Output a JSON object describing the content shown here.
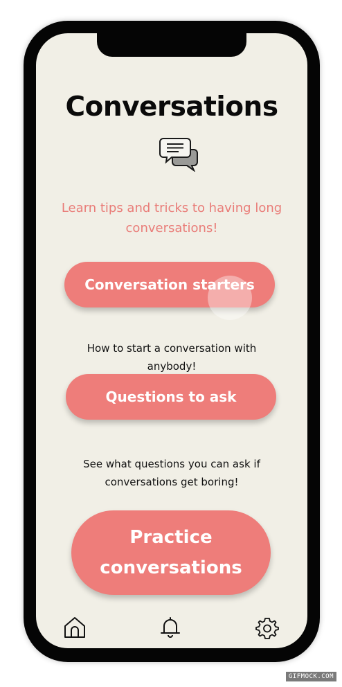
{
  "header": {
    "title": "Conversations",
    "subtitle": "Learn tips and tricks to having long conversations!",
    "icon": "chat-bubbles-icon"
  },
  "options": [
    {
      "label": "Conversation starters",
      "description": "How to start a conversation with anybody!"
    },
    {
      "label": "Questions to ask",
      "description": "See what questions you can ask if conversations get boring!"
    }
  ],
  "practice": {
    "line1": "Practice",
    "line2": "conversations"
  },
  "bottom_nav": {
    "items": [
      "home-icon",
      "bell-icon",
      "gear-icon"
    ]
  },
  "watermark": "GIFMOCK.COM",
  "colors": {
    "accent": "#ee7d7a",
    "background": "#f1efe6",
    "frame": "#050505",
    "subtitle": "#e97c78"
  }
}
